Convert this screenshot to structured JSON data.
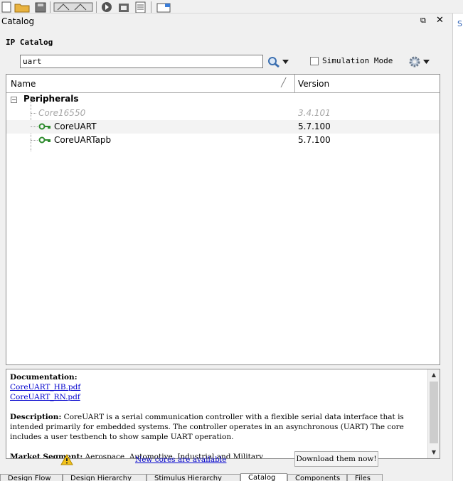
{
  "toolbar": {
    "icons": [
      "new-file-icon",
      "open-folder-icon",
      "save-icon",
      "layout-icon",
      "run-icon",
      "program-icon",
      "report-icon",
      "catalog-window-icon"
    ]
  },
  "pane": {
    "title": "Catalog",
    "restore_glyph": "⧉",
    "close_glyph": "✕"
  },
  "ip_catalog": {
    "title": "IP Catalog",
    "search_value": "uart",
    "simulation_mode_label": "Simulation Mode",
    "simulation_mode_checked": false
  },
  "table": {
    "columns": {
      "name": "Name",
      "version": "Version"
    },
    "group": {
      "label": "Peripherals",
      "expanded": true
    },
    "items": [
      {
        "name": "Core16550",
        "version": "3.4.101",
        "available": false
      },
      {
        "name": "CoreUART",
        "version": "5.7.100",
        "available": true,
        "selected": true
      },
      {
        "name": "CoreUARTapb",
        "version": "5.7.100",
        "available": true
      }
    ]
  },
  "documentation": {
    "heading": "Documentation",
    "links": [
      "CoreUART_HB.pdf",
      "CoreUART_RN.pdf"
    ],
    "description_label": "Description",
    "description_text": "CoreUART is a serial communication controller with a flexible serial data interface that is intended primarily for embedded systems. The controller operates in an asynchronous (UART) The core includes a user testbench to show sample UART operation.",
    "market_label": "Market Segment",
    "market_text": "Aerospace, Automotive, Industrial and Military"
  },
  "notification": {
    "text": "New cores are available",
    "button_label": "Download them now!"
  },
  "bottom_tabs": [
    {
      "label": "Design Flow",
      "active": false
    },
    {
      "label": "Design Hierarchy",
      "active": false
    },
    {
      "label": "Stimulus Hierarchy",
      "active": false
    },
    {
      "label": "Catalog",
      "active": true
    },
    {
      "label": "Components",
      "active": false
    },
    {
      "label": "Files",
      "active": false
    }
  ],
  "right_strip": {
    "label": "S"
  },
  "colors": {
    "link": "#0000cc",
    "selected_row": "#f3f3f3",
    "disabled_text": "#a6a6a6",
    "key_icon": "#2e8b2e"
  }
}
